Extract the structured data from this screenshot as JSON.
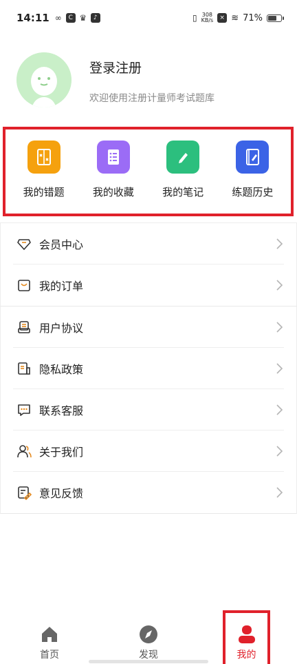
{
  "status_bar": {
    "time": "14:11",
    "net_speed_value": "308",
    "net_speed_unit": "KB/s",
    "battery": "71%",
    "battery_level": 0.71
  },
  "profile": {
    "login_label": "登录注册",
    "welcome_text": "欢迎使用注册计量师考试题库"
  },
  "quick_actions": [
    {
      "label": "我的错题",
      "icon": "wrong-questions-icon",
      "color": "#f5a10e"
    },
    {
      "label": "我的收藏",
      "icon": "favorites-icon",
      "color": "#9b6cf6"
    },
    {
      "label": "我的笔记",
      "icon": "notes-icon",
      "color": "#2cbf7e"
    },
    {
      "label": "练题历史",
      "icon": "practice-history-icon",
      "color": "#3b63e6"
    }
  ],
  "menu": {
    "group1": [
      {
        "label": "会员中心",
        "icon": "membership-icon"
      },
      {
        "label": "我的订单",
        "icon": "orders-icon"
      }
    ],
    "group2": [
      {
        "label": "用户协议",
        "icon": "user-agreement-icon"
      },
      {
        "label": "隐私政策",
        "icon": "privacy-policy-icon"
      },
      {
        "label": "联系客服",
        "icon": "customer-service-icon"
      },
      {
        "label": "关于我们",
        "icon": "about-us-icon"
      },
      {
        "label": "意见反馈",
        "icon": "feedback-icon"
      }
    ]
  },
  "tabbar": {
    "home": "首页",
    "discover": "发现",
    "mine": "我的"
  },
  "colors": {
    "accent_red": "#e0212b",
    "avatar_green": "#c9efc8",
    "icon_orange": "#e58a1f"
  }
}
